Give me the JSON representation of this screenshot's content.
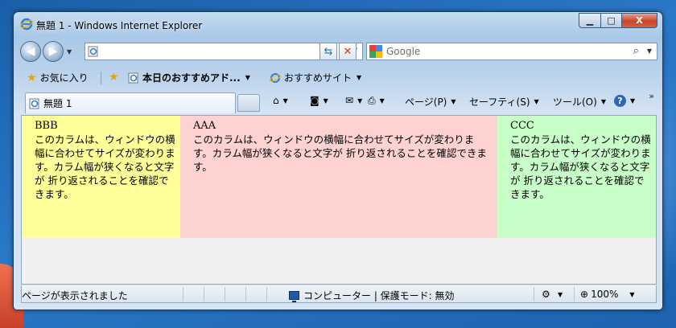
{
  "window": {
    "title": "無題 1 - Windows Internet Explorer",
    "controls": {
      "minimize": "▁",
      "maximize": "□",
      "close": "X"
    }
  },
  "address_bar": {
    "value": ""
  },
  "search": {
    "placeholder": "Google"
  },
  "favorites_bar": {
    "favorites_label": "お気に入り",
    "recommended_addons": "本日のおすすめアド...",
    "suggested_sites": "おすすめサイト"
  },
  "tab": {
    "title": "無題 1"
  },
  "command_bar": {
    "page": "ページ(P)",
    "safety": "セーフティ(S)",
    "tools": "ツール(O)",
    "overflow": "»"
  },
  "content": {
    "columns": [
      {
        "heading": "BBB",
        "text": "このカラムは、ウィンドウの横幅に合わせてサイズが変わります。カラム幅が狭くなると文字が 折り返されることを確認できます。",
        "color": "#ffff99"
      },
      {
        "heading": "AAA",
        "text": "このカラムは、ウィンドウの横幅に合わせてサイズが変わります。カラム幅が狭くなると文字が 折り返されることを確認できます。",
        "color": "#ffd2d2"
      },
      {
        "heading": "CCC",
        "text": "このカラムは、ウィンドウの横幅に合わせてサイズが変わります。カラム幅が狭くなると文字が 折り返されることを確認できます。",
        "color": "#c8ffc8"
      }
    ]
  },
  "status_bar": {
    "text": "ページが表示されました",
    "zone": "コンピューター | 保護モード: 無効",
    "zoom": "100%"
  }
}
